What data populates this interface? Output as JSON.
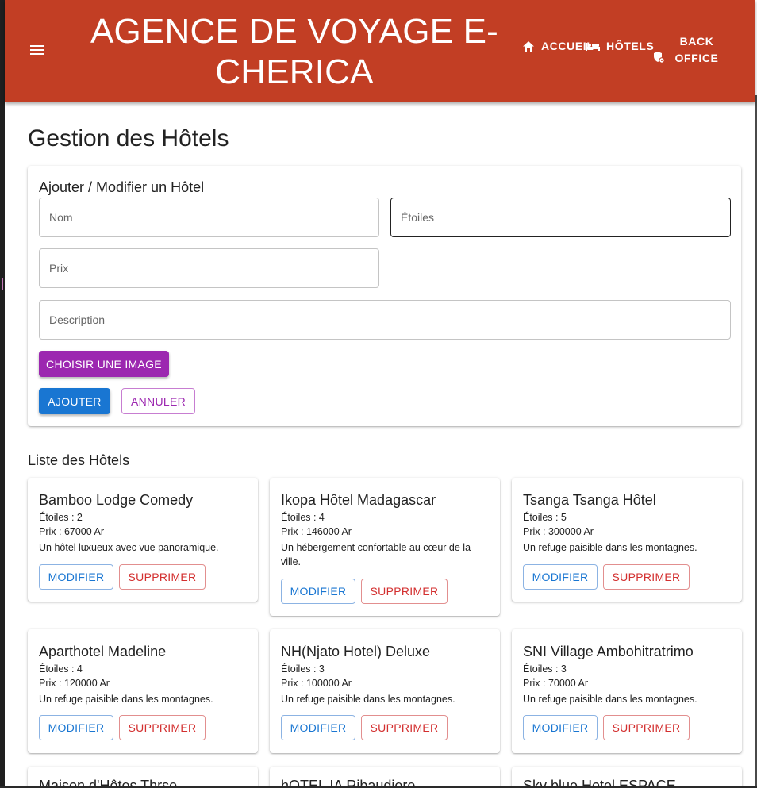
{
  "header": {
    "title": "AGENCE DE VOYAGE E-CHERICA",
    "nav": [
      {
        "label": "ACCUEIL",
        "icon": "home-icon"
      },
      {
        "label": "HÔTELS",
        "icon": "hotel-bed-icon"
      },
      {
        "label_line1": "BACK",
        "label_line2": "OFFICE",
        "icon": "admin-shield-icon"
      }
    ],
    "background": "#c23e24"
  },
  "page": {
    "title": "Gestion des Hôtels"
  },
  "form": {
    "title": "Ajouter / Modifier un Hôtel",
    "fields": {
      "nom": {
        "placeholder": "Nom",
        "value": ""
      },
      "etoiles": {
        "placeholder": "Étoiles",
        "value": ""
      },
      "prix": {
        "placeholder": "Prix",
        "value": ""
      },
      "description": {
        "placeholder": "Description",
        "value": ""
      }
    },
    "image_button": "CHOISIR UNE IMAGE",
    "submit_button": "AJOUTER",
    "cancel_button": "ANNULER"
  },
  "list": {
    "title": "Liste des Hôtels",
    "modify_label": "MODIFIER",
    "delete_label": "SUPPRIMER",
    "hotels": [
      {
        "name": "Bamboo Lodge Comedy",
        "stars": "Étoiles : 2",
        "price": "Prix : 67000 Ar",
        "description": "Un hôtel luxueux avec vue panoramique."
      },
      {
        "name": "Ikopa Hôtel Madagascar",
        "stars": "Étoiles : 4",
        "price": "Prix : 146000 Ar",
        "description": "Un hébergement confortable au cœur de la ville."
      },
      {
        "name": "Tsanga Tsanga Hôtel",
        "stars": "Étoiles : 5",
        "price": "Prix : 300000 Ar",
        "description": "Un refuge paisible dans les montagnes."
      },
      {
        "name": "Aparthotel Madeline",
        "stars": "Étoiles : 4",
        "price": "Prix : 120000 Ar",
        "description": "Un refuge paisible dans les montagnes."
      },
      {
        "name": "NH(Njato Hotel) Deluxe",
        "stars": "Étoiles : 3",
        "price": "Prix : 100000 Ar",
        "description": "Un refuge paisible dans les montagnes."
      },
      {
        "name": "SNI Village Ambohitratrimo",
        "stars": "Étoiles : 3",
        "price": "Prix : 70000 Ar",
        "description": "Un refuge paisible dans les montagnes."
      },
      {
        "name": "Maison d'Hôtes Thrse"
      },
      {
        "name": "hOTEL IA Ribaudiere"
      },
      {
        "name": "Sky blue Hotel ESPACE"
      }
    ]
  },
  "colors": {
    "primary": "#1976d2",
    "secondary": "#9c27b0",
    "error": "#d32f2f"
  }
}
